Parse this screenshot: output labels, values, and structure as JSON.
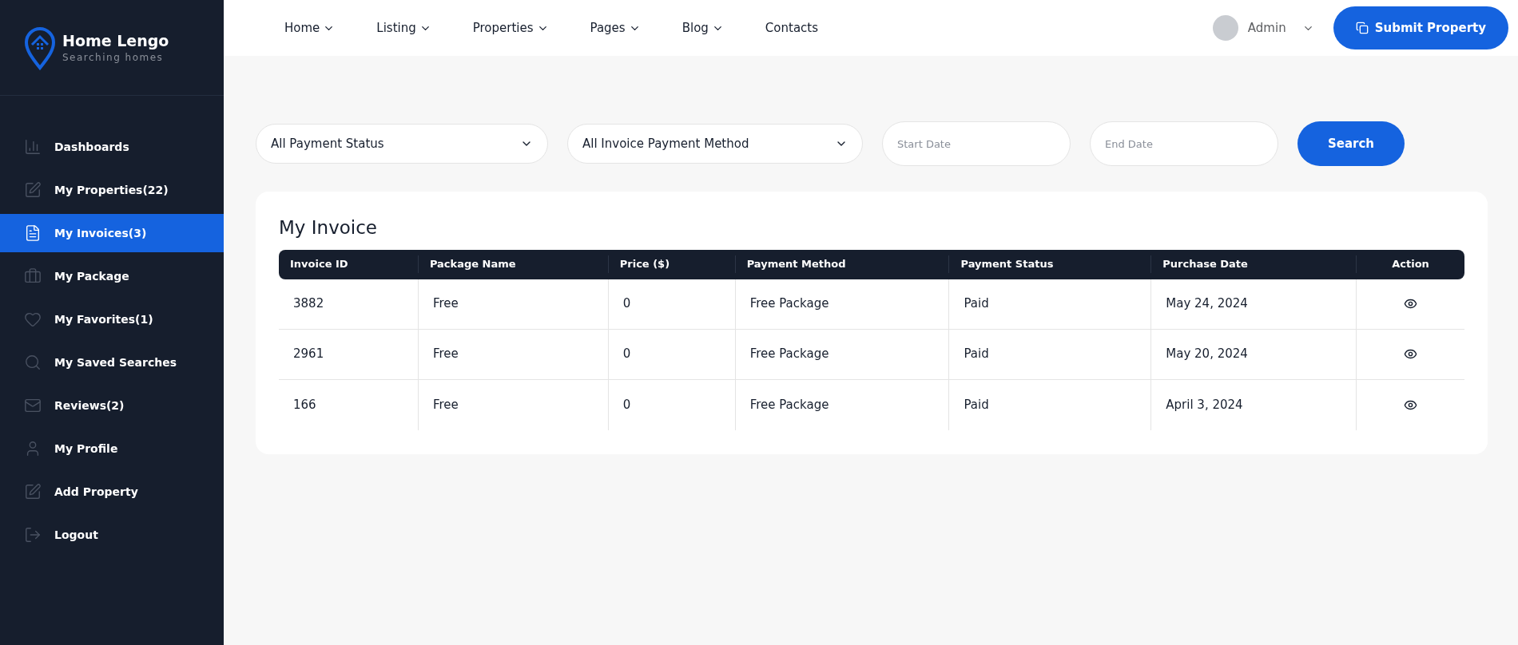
{
  "brand": {
    "name": "Home Lengo",
    "tagline": "Searching homes"
  },
  "sidebar": {
    "items": [
      {
        "label": "Dashboards",
        "selected": false
      },
      {
        "label": "My Properties(22)",
        "selected": false
      },
      {
        "label": "My Invoices(3)",
        "selected": true
      },
      {
        "label": "My Package",
        "selected": false
      },
      {
        "label": "My Favorites(1)",
        "selected": false
      },
      {
        "label": "My Saved Searches",
        "selected": false
      },
      {
        "label": "Reviews(2)",
        "selected": false
      },
      {
        "label": "My Profile",
        "selected": false
      },
      {
        "label": "Add Property",
        "selected": false
      },
      {
        "label": "Logout",
        "selected": false
      }
    ]
  },
  "nav": [
    {
      "label": "Home",
      "dropdown": true
    },
    {
      "label": "Listing",
      "dropdown": true
    },
    {
      "label": "Properties",
      "dropdown": true
    },
    {
      "label": "Pages",
      "dropdown": true
    },
    {
      "label": "Blog",
      "dropdown": true
    },
    {
      "label": "Contacts",
      "dropdown": false
    }
  ],
  "user": {
    "name": "Admin"
  },
  "submit_button": "Submit Property",
  "filters": {
    "payment_status": "All Payment Status",
    "payment_method": "All Invoice Payment Method",
    "start_date": {
      "placeholder": "Start Date"
    },
    "end_date": {
      "placeholder": "End Date"
    },
    "search_button": "Search"
  },
  "invoice": {
    "title": "My Invoice",
    "columns": [
      "Invoice ID",
      "Package Name",
      "Price ($)",
      "Payment Method",
      "Payment Status",
      "Purchase Date",
      "Action"
    ],
    "rows": [
      {
        "cells": [
          "3882",
          "Free",
          "0",
          "Free Package",
          "Paid",
          "May 24, 2024"
        ]
      },
      {
        "cells": [
          "2961",
          "Free",
          "0",
          "Free Package",
          "Paid",
          "May 20, 2024"
        ]
      },
      {
        "cells": [
          "166",
          "Free",
          "0",
          "Free Package",
          "Paid",
          "April 3, 2024"
        ]
      }
    ]
  }
}
